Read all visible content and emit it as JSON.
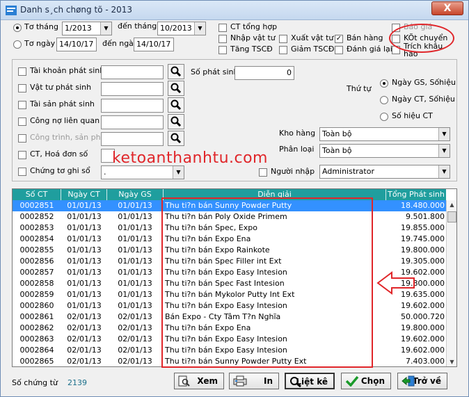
{
  "window": {
    "title": "Danh s¸ch chøng tõ - 2013",
    "close_label": "X"
  },
  "period": {
    "month_label": "Tơ tháng",
    "day_label": "Tơ ngày",
    "from_month": "1/2013",
    "to_month_label": "đến tháng",
    "to_month": "10/2013",
    "from_day": "14/10/17",
    "to_day_label": "đến ngày",
    "to_day": "14/10/17"
  },
  "types": {
    "ct_tong_hop": "CT tổng hợp",
    "nhap_vat_tu": "Nhập vật tư",
    "tang_tscd": "Tăng TSCĐ",
    "xuat_vat_tu": "Xuất vật tư",
    "giam_tscd": "Giảm TSCĐ",
    "ban_hang": "Bán hàng",
    "danh_gia_lai": "Đánh giá lại",
    "bao_gia": "Báo giá",
    "ket_chuyen": "KÕt chuyển",
    "trich_khau_hao": "Trích khâu hao"
  },
  "filters": {
    "tk_phat_sinh": "Tài khoản phát sinh",
    "vat_tu_phat_sinh": "Vật tư phát sinh",
    "tai_san_phat_sinh": "Tài sản phát sinh",
    "cong_no": "Công nợ liên quan",
    "cong_trinh": "Công trình, sản phẩm",
    "ct_hoa_don": "CT, Hoá đơn số",
    "chung_tu_ghi_so": "Chứng tơ ghi sổ",
    "so_phat_sinh_label": "Số phát sinh",
    "so_phat_sinh_value": "0",
    "chung_tu_ghi_so_value": "."
  },
  "sort": {
    "label": "Thứ tự",
    "opt1": "Ngày GS, Sốhiệu",
    "opt2": "Ngày CT, Sốhiệu",
    "opt3": "Số hiệu CT"
  },
  "warehouse": {
    "label": "Kho hàng",
    "value": "Toàn bộ"
  },
  "category": {
    "label": "Phân loại",
    "value": "Toàn bộ"
  },
  "entry_user": {
    "label": "Người nhập",
    "value": "Administrator"
  },
  "watermark": "ketoanthanhtu.com",
  "grid": {
    "headers": [
      "Số CT",
      "Ngày CT",
      "Ngày GS",
      "Diễn giải",
      "Tổng Phát sinh"
    ],
    "rows": [
      [
        "0002851",
        "01/01/13",
        "01/01/13",
        "Thu ti?n bán Sunny Powder Putty",
        "18.480.000"
      ],
      [
        "0002852",
        "01/01/13",
        "01/01/13",
        "Thu ti?n bán Poly Oxide Primem",
        "9.501.800"
      ],
      [
        "0002853",
        "01/01/13",
        "01/01/13",
        "Thu ti?n bán Spec, Expo",
        "19.855.000"
      ],
      [
        "0002854",
        "01/01/13",
        "01/01/13",
        "Thu ti?n bán Expo Ena",
        "19.745.000"
      ],
      [
        "0002855",
        "01/01/13",
        "01/01/13",
        "Thu ti?n bán Expo Rainkote",
        "19.800.000"
      ],
      [
        "0002856",
        "01/01/13",
        "01/01/13",
        "Thu ti?n bán Spec Filler int Ext",
        "19.305.000"
      ],
      [
        "0002857",
        "01/01/13",
        "01/01/13",
        "Thu ti?n bán Expo Easy Intesion",
        "19.602.000"
      ],
      [
        "0002858",
        "01/01/13",
        "01/01/13",
        "Thu ti?n bán Spec Fast Intesion",
        "19.800.000"
      ],
      [
        "0002859",
        "01/01/13",
        "01/01/13",
        "Thu ti?n bán Mykolor Putty Int Ext",
        "19.635.000"
      ],
      [
        "0002860",
        "01/01/13",
        "01/01/13",
        "Thu ti?n bán Expo Easy Intesion",
        "19.602.000"
      ],
      [
        "0002861",
        "02/01/13",
        "02/01/13",
        "Bán Expo - Cty Tâm T?n Nghĩa",
        "50.000.720"
      ],
      [
        "0002862",
        "02/01/13",
        "02/01/13",
        "Thu ti?n bán Expo Ena",
        "19.800.000"
      ],
      [
        "0002863",
        "02/01/13",
        "02/01/13",
        "Thu ti?n bán Expo Easy Intesion",
        "19.602.000"
      ],
      [
        "0002864",
        "02/01/13",
        "02/01/13",
        "Thu ti?n bán Expo Easy Intesion",
        "19.602.000"
      ],
      [
        "0002865",
        "02/01/13",
        "02/01/13",
        "Thu ti?n bán Sunny Powder Putty Ext",
        "7.403.000"
      ]
    ]
  },
  "footer": {
    "count_label": "Số chứng từ",
    "count_value": "2139",
    "btn_view": "Xem",
    "btn_print": "In",
    "btn_list": "Liệt kê",
    "btn_select": "Chọn",
    "btn_back": "Trở về"
  },
  "colors": {
    "header": "#1f9e9e",
    "selection": "#3391ff",
    "annotation": "#e0262a"
  }
}
